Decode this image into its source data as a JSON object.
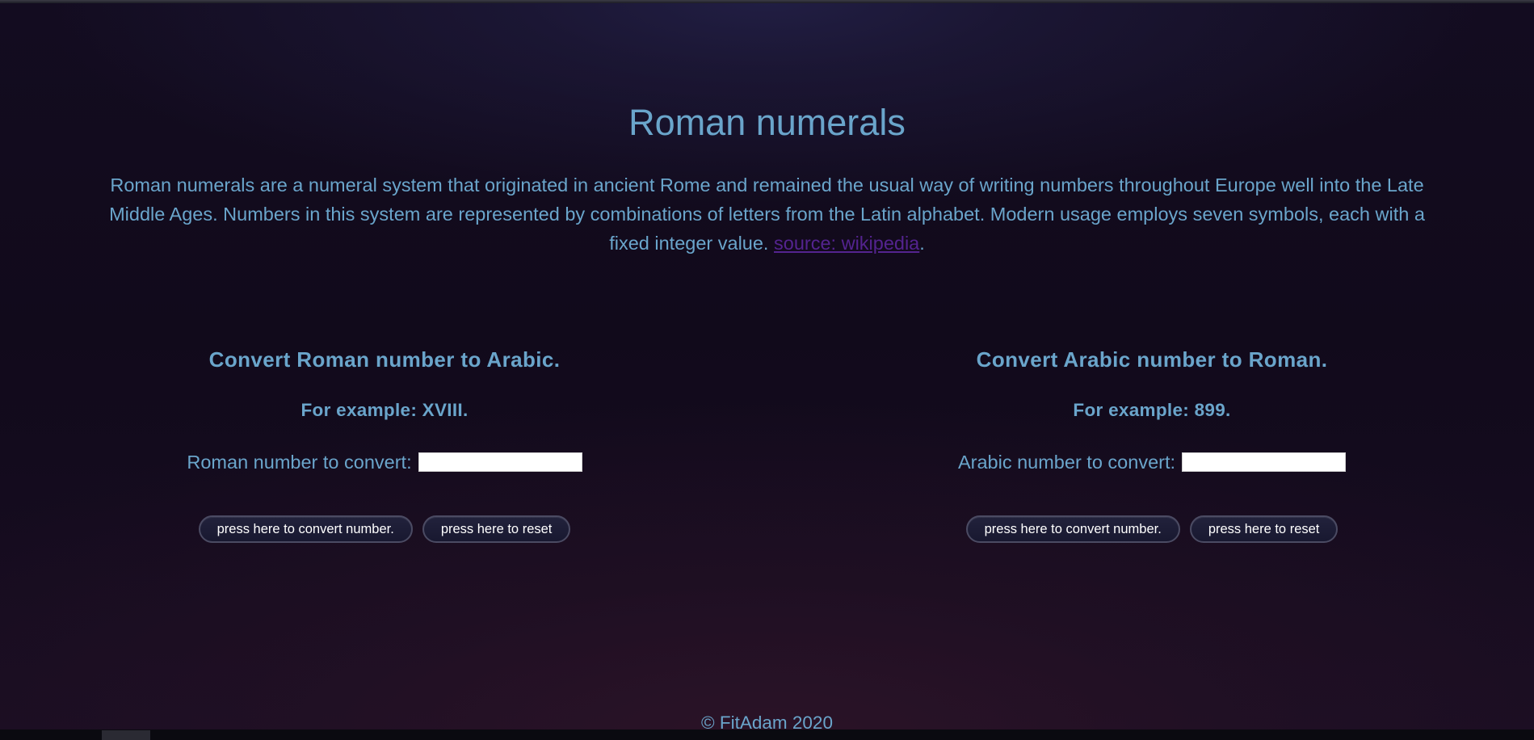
{
  "page": {
    "title": "Roman numerals",
    "intro_text": "Roman numerals are a numeral system that originated in ancient Rome and remained the usual way of writing numbers throughout Europe well into the Late Middle Ages. Numbers in this system are represented by combinations of letters from the Latin alphabet. Modern usage employs seven symbols, each with a fixed integer value.",
    "source_link_text": "source: wikipedia",
    "intro_end": "."
  },
  "roman_to_arabic": {
    "heading": "Convert Roman number to Arabic.",
    "example": "For example: XVIII.",
    "input_label": "Roman number to convert:",
    "input_value": "",
    "convert_button": "press here to convert number.",
    "reset_button": "press here to reset"
  },
  "arabic_to_roman": {
    "heading": "Convert Arabic number to Roman.",
    "example": "For example: 899.",
    "input_label": "Arabic number to convert:",
    "input_value": "",
    "convert_button": "press here to convert number.",
    "reset_button": "press here to reset"
  },
  "footer": {
    "text": "© FitAdam 2020"
  },
  "colors": {
    "text": "#6aa5cb",
    "link": "#54238f",
    "background": "#110a1b",
    "button_bg": "#1c1c34",
    "button_border": "#4b4b63"
  }
}
